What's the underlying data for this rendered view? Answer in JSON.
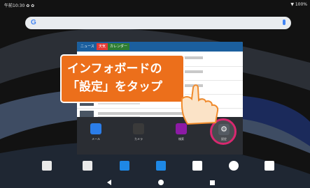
{
  "status": {
    "left": "午前10:30 ✿ ✿",
    "right": "▼ 100%"
  },
  "search": {
    "logo": "G"
  },
  "widget": {
    "tabs": [
      "ニュース",
      "天気",
      "カレンダー"
    ],
    "news_count": 5
  },
  "dock_apps": [
    {
      "label": "メール",
      "icon": "mail-icon",
      "color": "#2b7de9"
    },
    {
      "label": "カメラ",
      "icon": "camera-icon",
      "color": "#3a3a3a"
    },
    {
      "label": "検索",
      "icon": "yahoo-icon",
      "color": "#8c1aa5"
    },
    {
      "label": "設定",
      "icon": "gear-icon",
      "color": "#555b63"
    }
  ],
  "callout": {
    "line1": "インフォボードの",
    "line2": "「設定」をタップ"
  },
  "colors": {
    "callout": "#ec6f1b",
    "ring": "#d8286f",
    "widget_header": "#1b5f9e"
  }
}
